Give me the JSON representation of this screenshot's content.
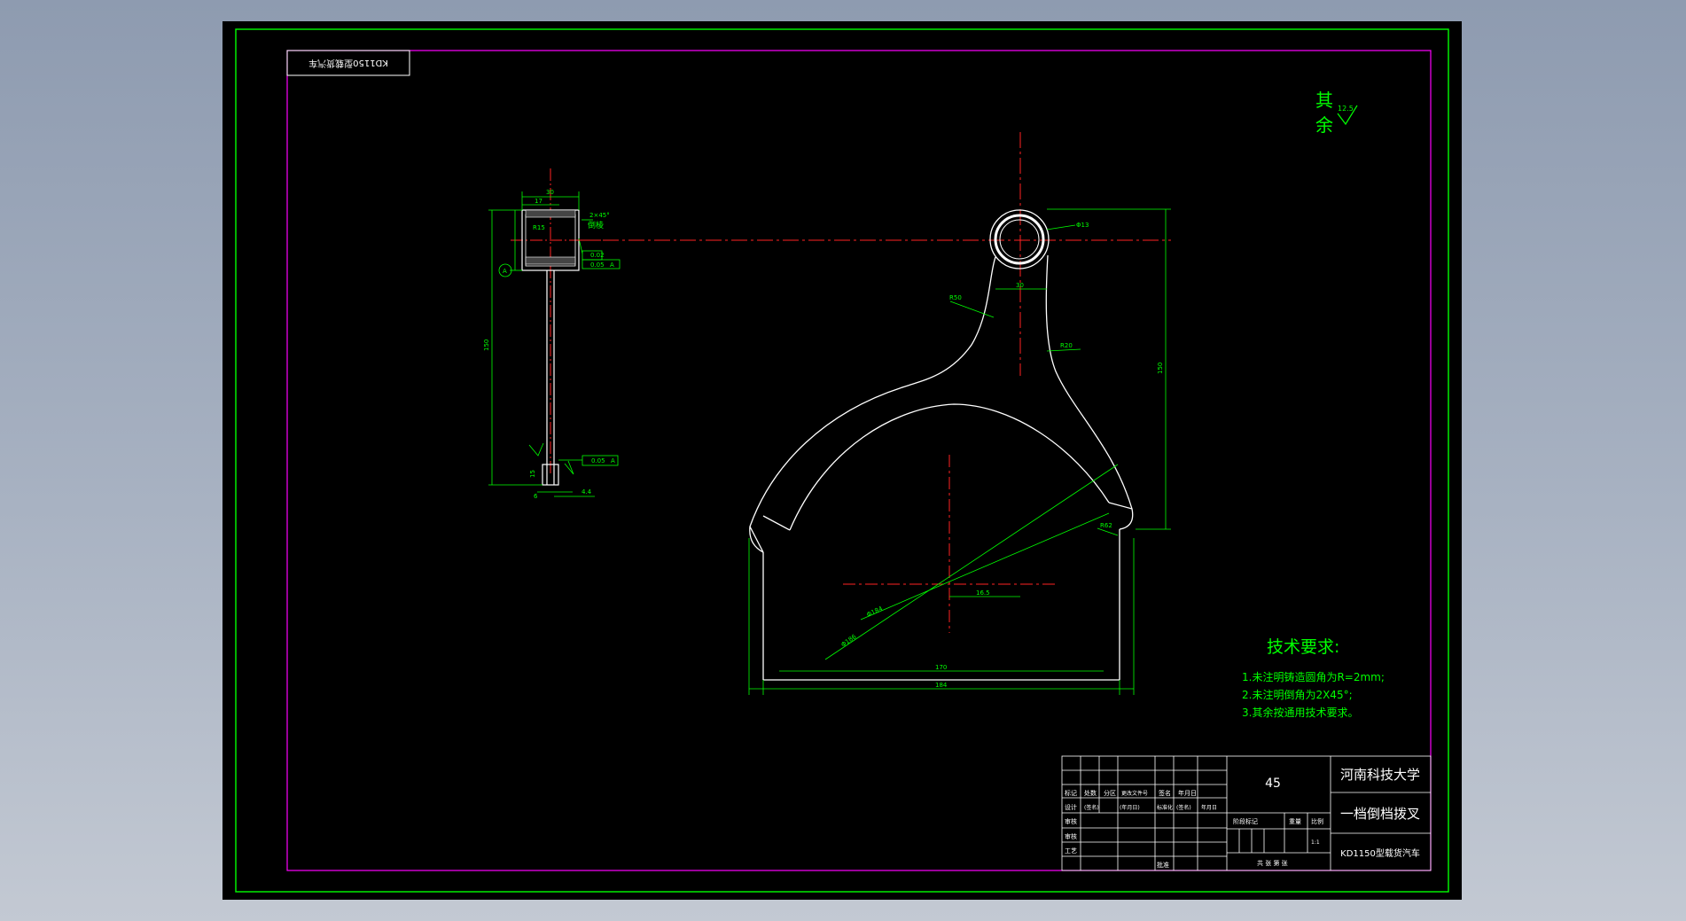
{
  "drawing": {
    "stamp_label": "KD1150型载货汽车",
    "roughness_note": {
      "text_1": "其",
      "text_2": "余",
      "value": "12.5"
    },
    "tech_requirements": {
      "title": "技术要求:",
      "items": [
        "1.未注明铸造圆角为R=2mm;",
        "2.未注明倒角为2X45°;",
        "3.其余按通用技术要求。"
      ]
    },
    "title_block": {
      "material": "45",
      "school": "河南科技大学",
      "part_name": "一档倒档拨叉",
      "project": "KD1150型载货汽车",
      "row_labels": [
        "标记",
        "处数",
        "分区",
        "更改文件号",
        "签名",
        "年月日"
      ],
      "design_row": [
        "设计",
        "(签名)",
        "(年月日)",
        "标准化",
        "(签名)",
        "年月日"
      ],
      "stage_labels": [
        "阶段标记",
        "重量",
        "比例"
      ],
      "scale": "1:1",
      "left_labels": [
        "审核",
        "工艺"
      ],
      "check_label": "审核",
      "approve_label": "批准",
      "sheet_label": "共 张 第 张"
    },
    "dimensions": {
      "d30": "30",
      "d17": "17",
      "r15": "R15",
      "chamfer": "2×45°",
      "key": "倒棱",
      "tol1": "0.02",
      "tol2": "0.05",
      "datum": "A",
      "tol3": "0.05",
      "len150": "150",
      "a": "6",
      "b": "15",
      "c": "4.4",
      "r50": "R50",
      "r20": "R20",
      "w30": "30",
      "phi": "Φ13",
      "h150": "150",
      "r62": "R62",
      "phi184": "Φ184",
      "phi186": "Φ186",
      "w170": "170",
      "w184": "184",
      "off": "16.5",
      "sym": "0.05"
    }
  }
}
